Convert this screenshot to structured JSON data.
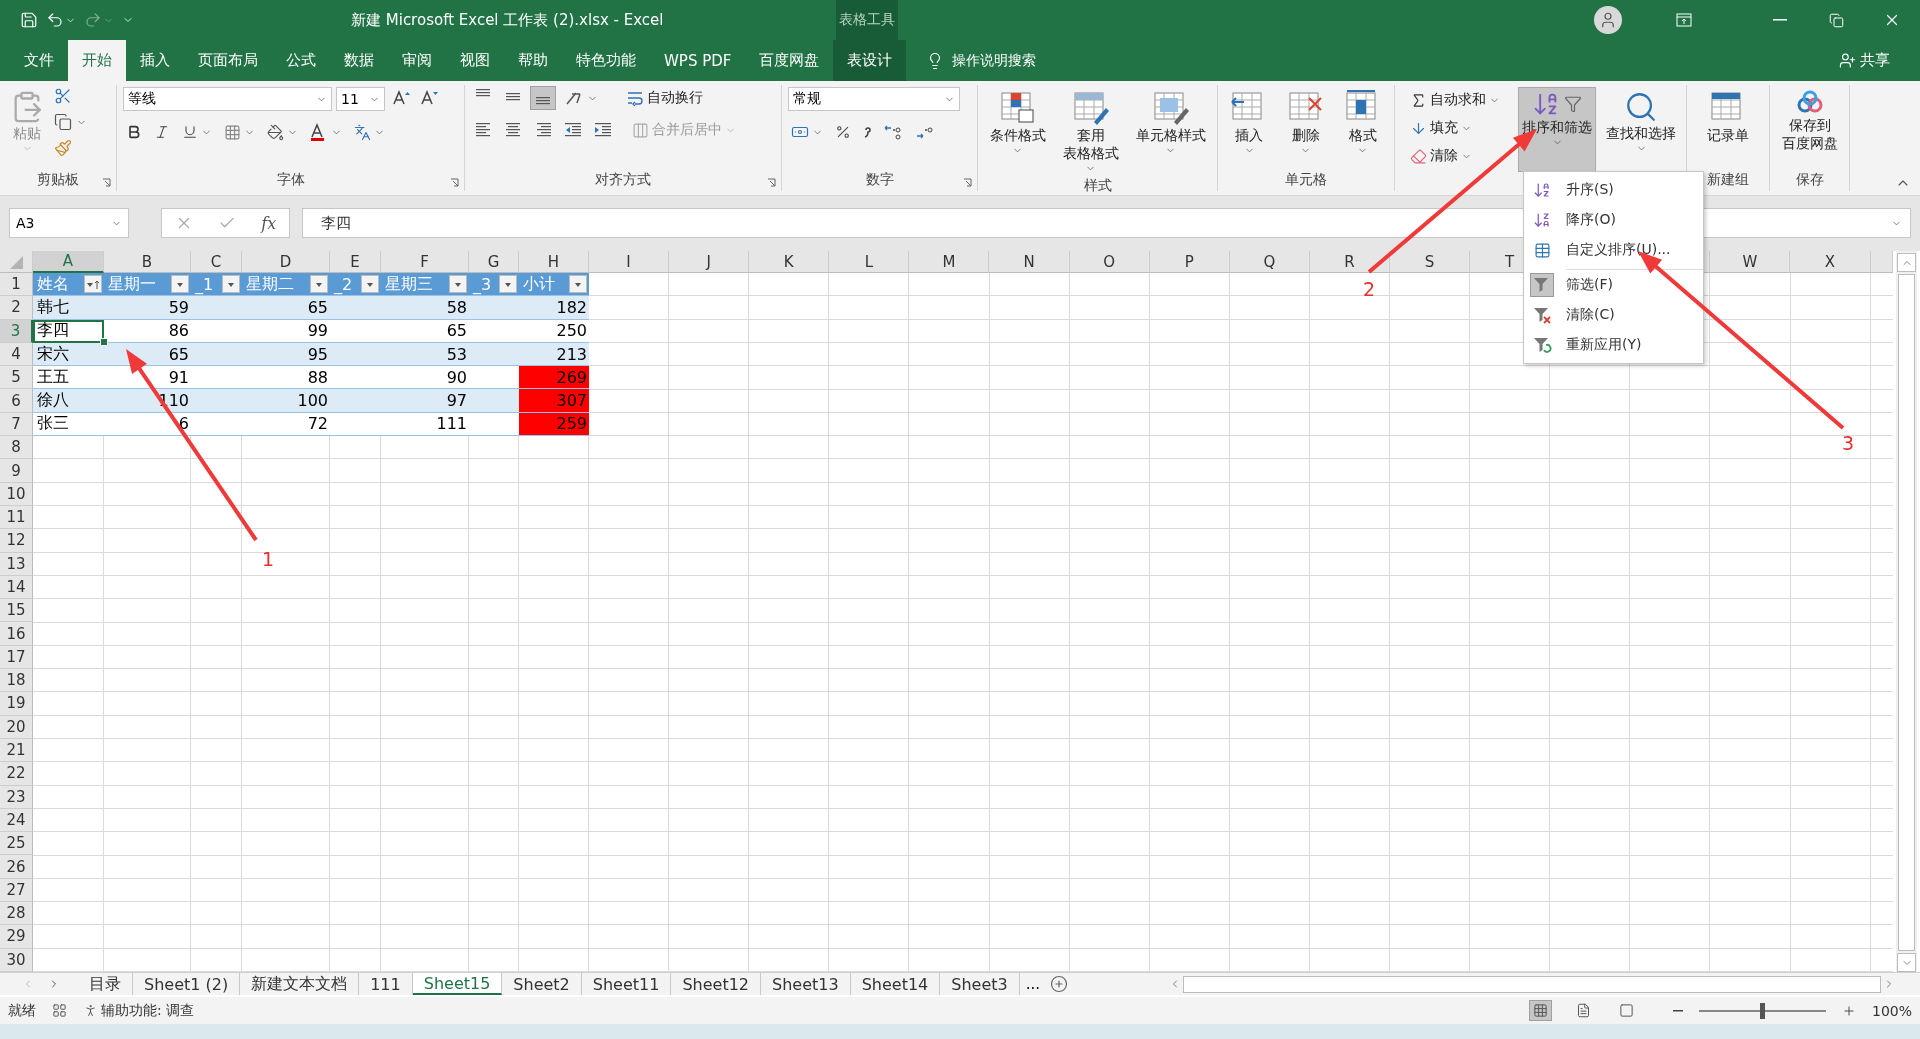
{
  "window": {
    "title": "新建 Microsoft Excel 工作表 (2).xlsx  -  Excel",
    "context_label": "表格工具"
  },
  "ribbon_tabs": [
    {
      "label": "文件",
      "selected": false,
      "kind": "normal"
    },
    {
      "label": "开始",
      "selected": true,
      "kind": "normal"
    },
    {
      "label": "插入",
      "selected": false,
      "kind": "normal"
    },
    {
      "label": "页面布局",
      "selected": false,
      "kind": "normal"
    },
    {
      "label": "公式",
      "selected": false,
      "kind": "normal"
    },
    {
      "label": "数据",
      "selected": false,
      "kind": "normal"
    },
    {
      "label": "审阅",
      "selected": false,
      "kind": "normal"
    },
    {
      "label": "视图",
      "selected": false,
      "kind": "normal"
    },
    {
      "label": "帮助",
      "selected": false,
      "kind": "normal"
    },
    {
      "label": "特色功能",
      "selected": false,
      "kind": "normal"
    },
    {
      "label": "WPS PDF",
      "selected": false,
      "kind": "normal"
    },
    {
      "label": "百度网盘",
      "selected": false,
      "kind": "normal"
    },
    {
      "label": "表设计",
      "selected": false,
      "kind": "context"
    }
  ],
  "tell_me": "操作说明搜索",
  "share": "共享",
  "ribbon": {
    "clipboard": {
      "paste": "粘贴",
      "label": "剪贴板"
    },
    "font": {
      "name": "等线",
      "size": "11",
      "label": "字体"
    },
    "alignment": {
      "wrap": "自动换行",
      "merge": {
        "label": "合并后居中",
        "disabled": true
      },
      "label": "对齐方式"
    },
    "number": {
      "format": "常规",
      "label": "数字"
    },
    "styles": {
      "buttons": [
        {
          "lines": [
            "条件格式"
          ],
          "kind": "conditional"
        },
        {
          "lines": [
            "套用",
            "表格格式"
          ],
          "kind": "table"
        },
        {
          "lines": [
            "单元格样式"
          ],
          "kind": "cellstyle"
        }
      ],
      "label": "样式"
    },
    "cells": {
      "buttons": [
        {
          "lines": [
            "插入"
          ],
          "kind": "insert"
        },
        {
          "lines": [
            "删除"
          ],
          "kind": "delete"
        },
        {
          "lines": [
            "格式"
          ],
          "kind": "format"
        }
      ],
      "label": "单元格"
    },
    "editing": {
      "autosum": "自动求和",
      "fill": "填充",
      "clear": "清除",
      "sort": {
        "label": "排序和筛选",
        "open": true
      },
      "find": "查找和选择"
    },
    "new_group": {
      "button": "记录单",
      "label": "新建组"
    },
    "save": {
      "lines": [
        "保存到",
        "百度网盘"
      ],
      "label": "保存"
    }
  },
  "formula_bar": {
    "name_box": "A3",
    "fx": "fx",
    "value": "李四"
  },
  "sheet": {
    "columns": [
      "A",
      "B",
      "C",
      "D",
      "E",
      "F",
      "G",
      "H",
      "I",
      "J",
      "K",
      "L",
      "M",
      "N",
      "O",
      "P",
      "Q",
      "R",
      "S",
      "T"
    ],
    "columns_after_menu": [
      "W",
      "X"
    ],
    "row_numbers": [
      "1",
      "2",
      "3",
      "4",
      "5",
      "6",
      "7",
      "8",
      "9",
      "10",
      "11",
      "12",
      "13",
      "14",
      "15",
      "16",
      "17",
      "18",
      "19",
      "20",
      "21",
      "22",
      "23",
      "24",
      "25",
      "26",
      "27",
      "28",
      "29",
      "30"
    ],
    "table": {
      "headers": [
        {
          "label": "姓名",
          "sorted": true
        },
        {
          "label": "星期一",
          "sorted": false
        },
        {
          "label": "_1",
          "sorted": false
        },
        {
          "label": "星期二",
          "sorted": false
        },
        {
          "label": "_2",
          "sorted": false
        },
        {
          "label": "星期三",
          "sorted": false
        },
        {
          "label": "_3",
          "sorted": false
        },
        {
          "label": "小计",
          "sorted": false
        }
      ],
      "rows": [
        {
          "cells": [
            "韩七",
            "59",
            "",
            "65",
            "",
            "58",
            "",
            "182"
          ],
          "selected": false,
          "total_flagged": false
        },
        {
          "cells": [
            "李四",
            "86",
            "",
            "99",
            "",
            "65",
            "",
            "250"
          ],
          "selected": true,
          "total_flagged": false
        },
        {
          "cells": [
            "宋六",
            "65",
            "",
            "95",
            "",
            "53",
            "",
            "213"
          ],
          "selected": false,
          "total_flagged": false
        },
        {
          "cells": [
            "王五",
            "91",
            "",
            "88",
            "",
            "90",
            "",
            "269"
          ],
          "selected": false,
          "total_flagged": true
        },
        {
          "cells": [
            "徐八",
            "110",
            "",
            "100",
            "",
            "97",
            "",
            "307"
          ],
          "selected": false,
          "total_flagged": true
        },
        {
          "cells": [
            "张三",
            "6",
            "",
            "72",
            "",
            "111",
            "",
            "259"
          ],
          "selected": false,
          "total_flagged": true
        }
      ]
    }
  },
  "sheet_tabs": [
    {
      "label": "目录",
      "selected": false
    },
    {
      "label": "Sheet1 (2)",
      "selected": false
    },
    {
      "label": "新建文本文档",
      "selected": false
    },
    {
      "label": "111",
      "selected": false
    },
    {
      "label": "Sheet15",
      "selected": true
    },
    {
      "label": "Sheet2",
      "selected": false
    },
    {
      "label": "Sheet11",
      "selected": false
    },
    {
      "label": "Sheet12",
      "selected": false
    },
    {
      "label": "Sheet13",
      "selected": false
    },
    {
      "label": "Sheet14",
      "selected": false
    },
    {
      "label": "Sheet3",
      "selected": false
    }
  ],
  "sheet_tabs_more": "...",
  "status_bar": {
    "ready": "就绪",
    "accessibility": "辅助功能: 调查",
    "zoom": "100%",
    "zoom_slider": {
      "level": 0.5
    }
  },
  "sort_menu": {
    "items": [
      {
        "label": "升序(S)",
        "kind": "ascending",
        "checked": false,
        "divider_after": false
      },
      {
        "label": "降序(O)",
        "kind": "descending",
        "checked": false,
        "divider_after": false
      },
      {
        "label": "自定义排序(U)...",
        "kind": "custom",
        "checked": false,
        "divider_after": true
      },
      {
        "label": "筛选(F)",
        "kind": "filter",
        "checked": true,
        "divider_after": false
      },
      {
        "label": "清除(C)",
        "kind": "clear",
        "checked": false,
        "divider_after": false
      },
      {
        "label": "重新应用(Y)",
        "kind": "reapply",
        "checked": false,
        "divider_after": false
      }
    ]
  },
  "annotations": [
    {
      "label": "1"
    },
    {
      "label": "2"
    },
    {
      "label": "3"
    }
  ]
}
